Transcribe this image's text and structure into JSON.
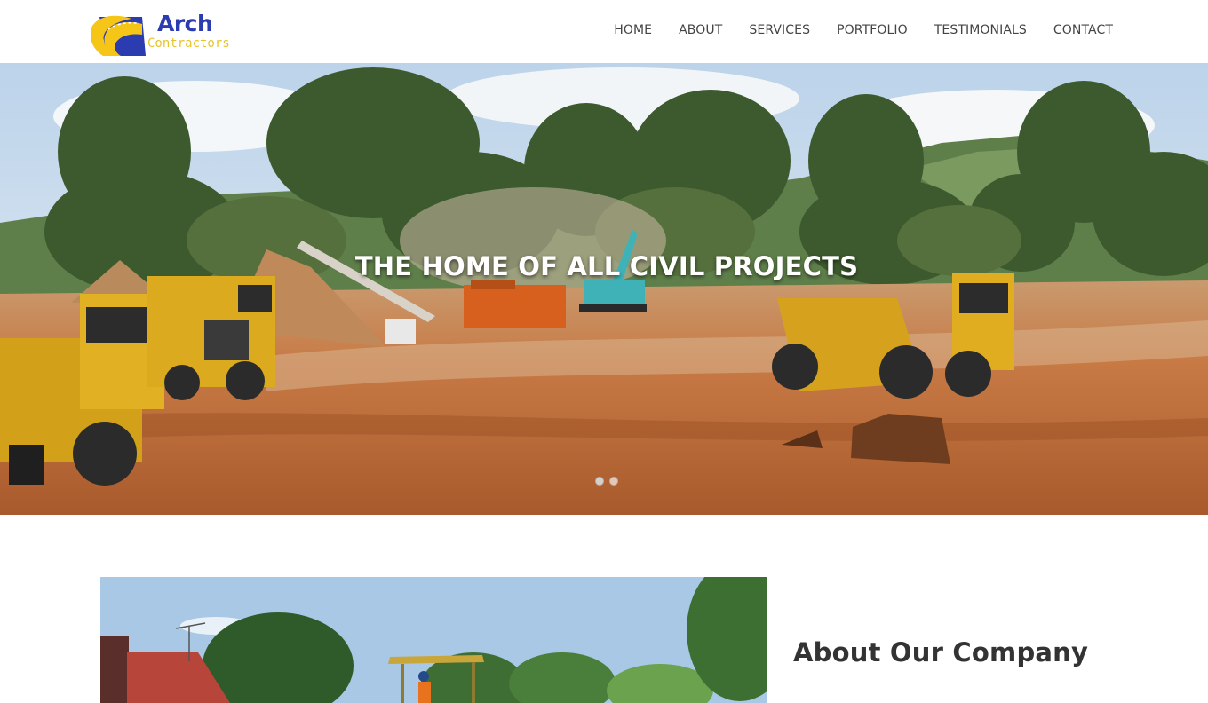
{
  "logo": {
    "word1": "Arch",
    "word2": "Contractors",
    "brand_blue": "#2b3bb0",
    "brand_yellow": "#f5c518"
  },
  "nav": {
    "items": [
      "HOME",
      "ABOUT",
      "SERVICES",
      "PORTFOLIO",
      "TESTIMONIALS",
      "CONTACT"
    ]
  },
  "hero": {
    "title": "THE HOME OF ALL CIVIL PROJECTS",
    "slide_count": 2,
    "active_slide": 1
  },
  "about": {
    "title": "About Our Company"
  }
}
